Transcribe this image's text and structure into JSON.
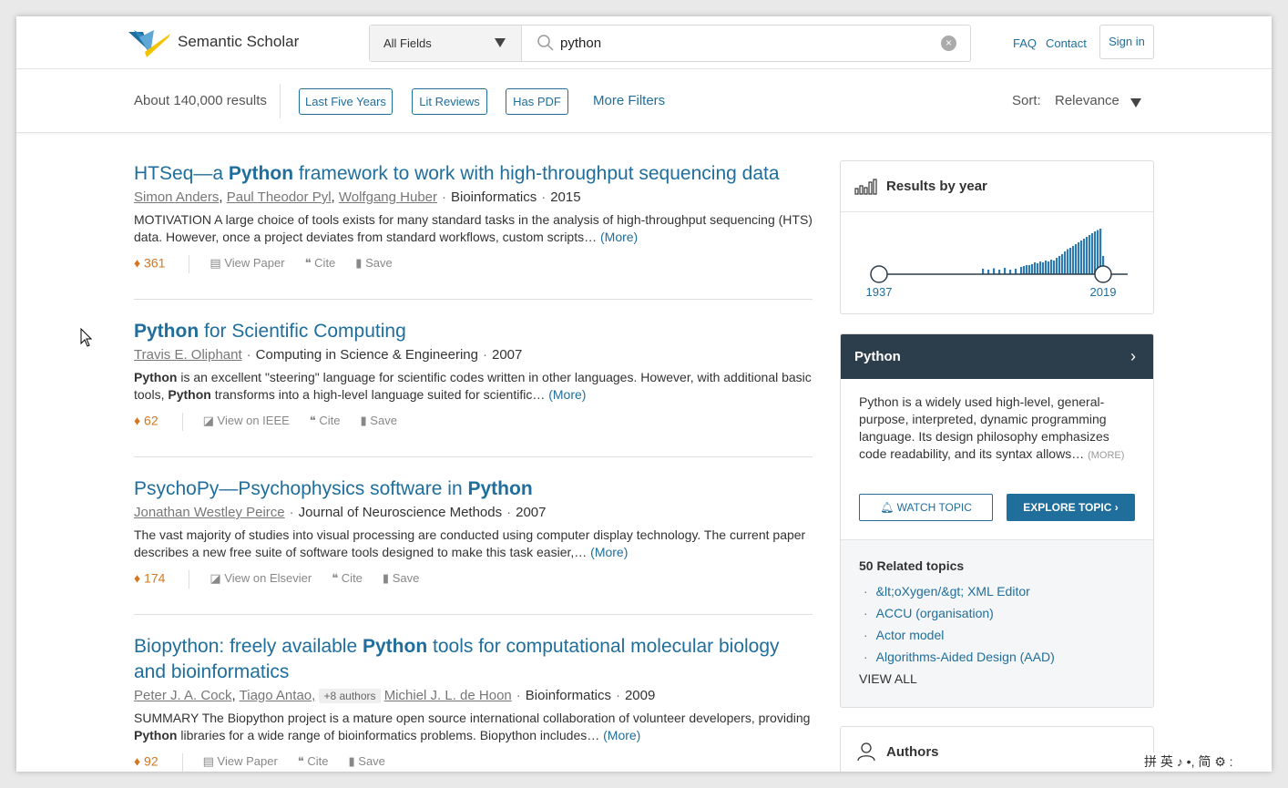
{
  "header": {
    "brand": "Semantic Scholar",
    "field_select": "All Fields",
    "search_query": "python",
    "links": [
      "FAQ",
      "Contact"
    ],
    "sign_in": "Sign in"
  },
  "filters": {
    "results_count": "About 140,000 results",
    "chips": [
      "Last Five Years",
      "Lit Reviews",
      "Has PDF"
    ],
    "more_filters": "More Filters",
    "sort_label": "Sort:",
    "sort_value": "Relevance"
  },
  "results": [
    {
      "title_parts": [
        "HTSeq—a ",
        "Python",
        " framework to work with high-throughput sequencing data"
      ],
      "authors": [
        "Simon Anders",
        "Paul Theodor Pyl",
        "Wolfgang Huber"
      ],
      "venue": "Bioinformatics",
      "year": "2015",
      "abstract": "MOTIVATION A large choice of tools exists for many standard tasks in the analysis of high-throughput sequencing (HTS) data. However, once a project deviates from standard workflows, custom scripts…",
      "more": "(More)",
      "citations": "361",
      "view": "View Paper",
      "cite": "Cite",
      "save": "Save"
    },
    {
      "title_parts": [
        "Python",
        " for Scientific Computing"
      ],
      "authors": [
        "Travis E. Oliphant"
      ],
      "venue": "Computing in Science & Engineering",
      "year": "2007",
      "abstract_parts": [
        "Python",
        " is an excellent \"steering\" language for scientific codes written in other languages. However, with additional basic tools, ",
        "Python",
        " transforms into a high-level language suited for scientific…"
      ],
      "more": "(More)",
      "citations": "62",
      "view": "View on IEEE",
      "cite": "Cite",
      "save": "Save"
    },
    {
      "title_parts": [
        "PsychoPy—Psychophysics software in ",
        "Python"
      ],
      "authors": [
        "Jonathan Westley Peirce"
      ],
      "venue": "Journal of Neuroscience Methods",
      "year": "2007",
      "abstract": "The vast majority of studies into visual processing are conducted using computer display technology. The current paper describes a new free suite of software tools designed to make this task easier,…",
      "more": "(More)",
      "citations": "174",
      "view": "View on Elsevier",
      "cite": "Cite",
      "save": "Save"
    },
    {
      "title_parts": [
        "Biopython: freely available ",
        "Python",
        " tools for computational molecular biology and bioinformatics"
      ],
      "authors": [
        "Peter J. A. Cock",
        "Tiago Antao,",
        "Michiel J. L. de Hoon"
      ],
      "more_authors": "+8 authors",
      "venue": "Bioinformatics",
      "year": "2009",
      "abstract_parts": [
        "SUMMARY The Biopython project is a mature open source international collaboration of volunteer developers, providing ",
        "Python",
        " libraries for a wide range of bioinformatics problems. Biopython includes…"
      ],
      "more": "(More)",
      "citations": "92",
      "view": "View Paper",
      "cite": "Cite",
      "save": "Save"
    }
  ],
  "year_panel": {
    "title": "Results by year",
    "start_year": "1937",
    "end_year": "2019",
    "chart_data": {
      "type": "bar",
      "x_range": [
        1937,
        2019
      ],
      "note_values": "relative bar heights (0-1) for years 1975-2019, read from histogram",
      "years": [
        1975,
        1977,
        1979,
        1981,
        1983,
        1985,
        1987,
        1989,
        1990,
        1991,
        1992,
        1993,
        1994,
        1995,
        1996,
        1997,
        1998,
        1999,
        2000,
        2001,
        2002,
        2003,
        2004,
        2005,
        2006,
        2007,
        2008,
        2009,
        2010,
        2011,
        2012,
        2013,
        2014,
        2015,
        2016,
        2017,
        2018,
        2019
      ],
      "values": [
        0.12,
        0.1,
        0.13,
        0.1,
        0.14,
        0.1,
        0.12,
        0.16,
        0.18,
        0.2,
        0.2,
        0.22,
        0.26,
        0.24,
        0.28,
        0.26,
        0.3,
        0.28,
        0.32,
        0.3,
        0.36,
        0.4,
        0.44,
        0.5,
        0.55,
        0.58,
        0.62,
        0.66,
        0.7,
        0.74,
        0.78,
        0.82,
        0.86,
        0.9,
        0.94,
        0.97,
        1.0,
        0.4
      ]
    }
  },
  "topic_panel": {
    "topic": "Python",
    "description": "Python is a widely used high-level, general-purpose, interpreted, dynamic programming language. Its design philosophy emphasizes code readability, and its syntax allows…",
    "more": "(MORE)",
    "watch": "WATCH TOPIC",
    "explore": "EXPLORE TOPIC ›",
    "related_title": "50 Related topics",
    "related": [
      "&lt;oXygen/&gt; XML Editor",
      "ACCU (organisation)",
      "Actor model",
      "Algorithms-Aided Design (AAD)"
    ],
    "view_all": "VIEW ALL"
  },
  "authors_panel": {
    "title": "Authors"
  },
  "ime_bar": "拼 英 ♪ •, 简 ⚙ :",
  "colors": {
    "link": "#1f6e9c",
    "citation": "#d4761f",
    "topic_header": "#2c3e4c"
  }
}
